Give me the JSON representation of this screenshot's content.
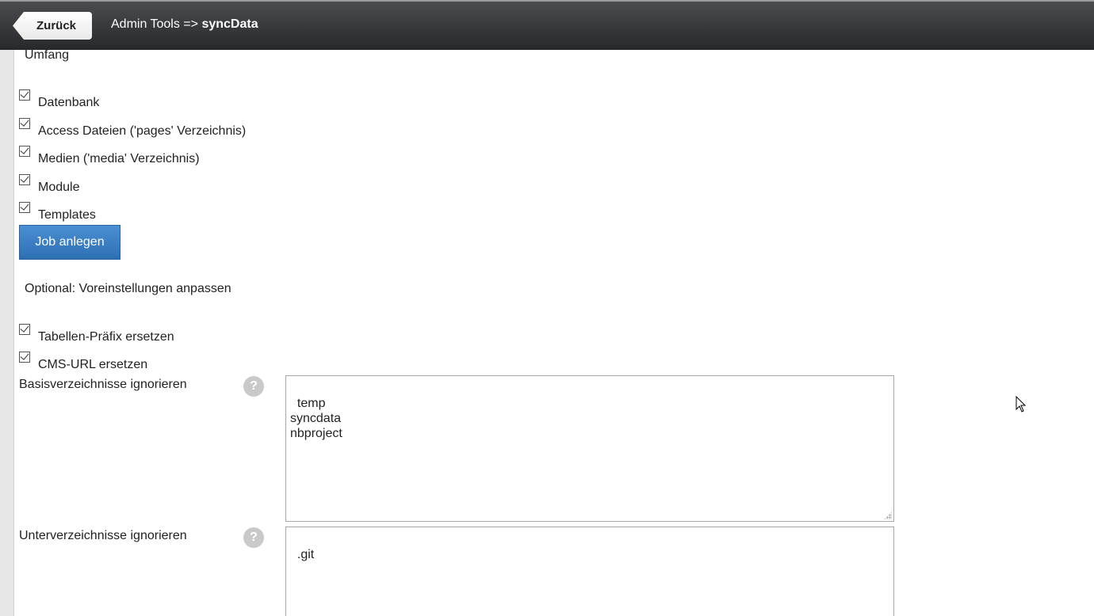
{
  "header": {
    "back_label": "Zurück",
    "title_prefix": "Admin Tools =>",
    "title_strong": "syncData"
  },
  "scope": {
    "heading": "Umfang",
    "options": [
      {
        "label": "Datenbank",
        "checked": true
      },
      {
        "label": "Access Dateien ('pages' Verzeichnis)",
        "checked": true
      },
      {
        "label": "Medien ('media' Verzeichnis)",
        "checked": true
      },
      {
        "label": "Module",
        "checked": true
      },
      {
        "label": "Templates",
        "checked": true
      }
    ],
    "create_job_label": "Job anlegen"
  },
  "optional": {
    "heading": "Optional: Voreinstellungen anpassen",
    "options": [
      {
        "label": "Tabellen-Präfix ersetzen",
        "checked": true
      },
      {
        "label": "CMS-URL ersetzen",
        "checked": true
      }
    ]
  },
  "fields": {
    "base_dirs": {
      "label": "Basisverzeichnisse ignorieren",
      "help": "?",
      "value": "temp\nsyncdata\nnbproject"
    },
    "sub_dirs": {
      "label": "Unterverzeichnisse ignorieren",
      "help": "?",
      "value": ".git"
    }
  },
  "colors": {
    "header_bg": "#2f3134",
    "primary_button": "#3a7fc4",
    "help_icon": "#c9c9c9"
  }
}
